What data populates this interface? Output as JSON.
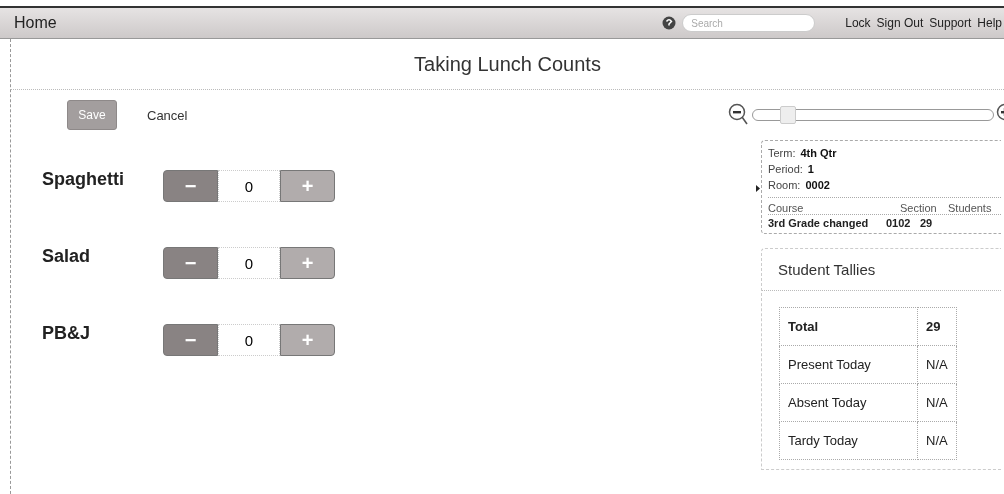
{
  "top_bar": {
    "home": "Home",
    "search": {
      "placeholder": "Search"
    },
    "links": [
      "Lock",
      "Sign Out",
      "Support",
      "Help"
    ]
  },
  "page_title": "Taking Lunch Counts",
  "toolbar": {
    "save": "Save",
    "cancel": "Cancel",
    "zoom": {
      "level": 0.12
    }
  },
  "items": [
    {
      "name": "Spaghetti",
      "minus": "−",
      "value": "0",
      "plus": "+"
    },
    {
      "name": "Salad",
      "minus": "−",
      "value": "0",
      "plus": "+"
    },
    {
      "name": "PB&J",
      "minus": "−",
      "value": "0",
      "plus": "+"
    }
  ],
  "section_info": {
    "fields": [
      {
        "label": "Term:",
        "value": "4th Qtr"
      },
      {
        "label": "Period:",
        "value": "1"
      },
      {
        "label": "Room:",
        "value": "0002"
      }
    ],
    "columns": [
      "Course",
      "Section",
      "Students"
    ],
    "row": [
      "3rd Grade changed",
      "0102",
      "29"
    ]
  },
  "tallies": {
    "title": "Student Tallies",
    "rows": [
      {
        "label": "Total",
        "value": "29",
        "kind": "total"
      },
      {
        "label": "Present Today",
        "value": "N/A",
        "kind": "count"
      },
      {
        "label": "Absent Today",
        "value": "N/A",
        "kind": "count"
      },
      {
        "label": "Tardy Today",
        "value": "N/A",
        "kind": "count"
      }
    ]
  }
}
